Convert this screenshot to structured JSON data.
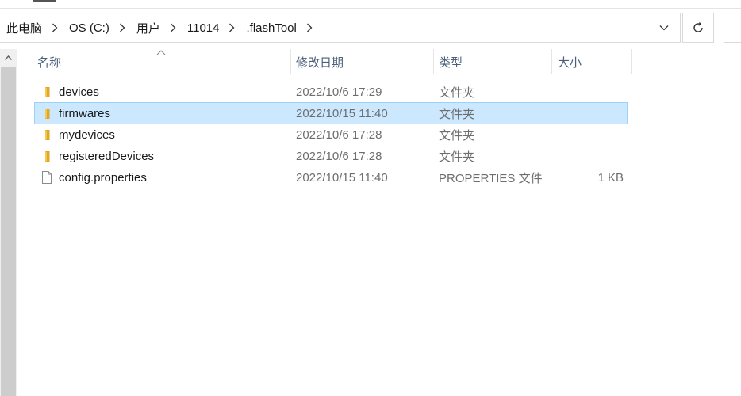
{
  "address": {
    "crumbs": [
      "此电脑",
      "OS (C:)",
      "用户",
      "11014",
      ".flashTool"
    ]
  },
  "columns": {
    "name": "名称",
    "modified": "修改日期",
    "type": "类型",
    "size": "大小"
  },
  "files": [
    {
      "name": "devices",
      "modified": "2022/10/6 17:29",
      "type": "文件夹",
      "size": "",
      "kind": "folder",
      "selected": false
    },
    {
      "name": "firmwares",
      "modified": "2022/10/15 11:40",
      "type": "文件夹",
      "size": "",
      "kind": "folder",
      "selected": true
    },
    {
      "name": "mydevices",
      "modified": "2022/10/6 17:28",
      "type": "文件夹",
      "size": "",
      "kind": "folder",
      "selected": false
    },
    {
      "name": "registeredDevices",
      "modified": "2022/10/6 17:28",
      "type": "文件夹",
      "size": "",
      "kind": "folder",
      "selected": false
    },
    {
      "name": "config.properties",
      "modified": "2022/10/15 11:40",
      "type": "PROPERTIES 文件",
      "size": "1 KB",
      "kind": "file",
      "selected": false
    }
  ],
  "colors": {
    "selection_bg": "#cce8ff",
    "selection_border": "#99d1ff",
    "folder": "#f7c94b",
    "header_text": "#4c607a"
  },
  "icons": {
    "folder": "folder-icon",
    "file": "file-icon",
    "refresh": "refresh-icon",
    "dropdown": "chevron-down-icon",
    "separator": "chevron-right-icon",
    "sort": "sort-up-icon",
    "scroll_up": "scroll-up-arrow-icon"
  }
}
